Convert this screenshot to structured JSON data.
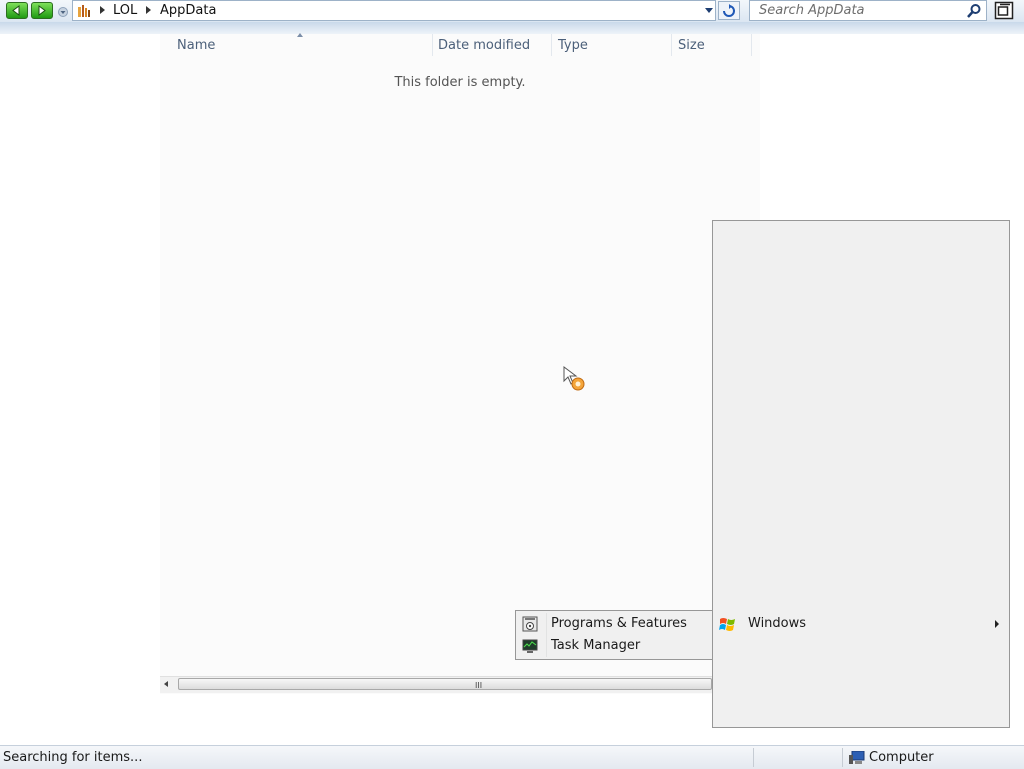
{
  "address_bar": {
    "breadcrumbs": [
      "LOL",
      "AppData"
    ]
  },
  "search": {
    "placeholder": "Search AppData"
  },
  "file_list": {
    "columns": [
      "Name",
      "Date modified",
      "Type",
      "Size"
    ],
    "empty_message": "This folder is empty.",
    "scroll_grip": "III"
  },
  "context_menu": {
    "items": [
      {
        "label": "Programs & Features",
        "icon": "programs-features-icon"
      },
      {
        "label": "Task Manager",
        "icon": "task-manager-icon"
      }
    ]
  },
  "start_menu": {
    "windows_label": "Windows",
    "windows_icon": "windows-logo-icon"
  },
  "status_bar": {
    "status_text": "Searching for items...",
    "zone_label": "Computer"
  },
  "colors": {
    "nav_green": "#2fb021",
    "accent_blue": "#1e3e72",
    "menu_bg": "#f0f0f0"
  }
}
